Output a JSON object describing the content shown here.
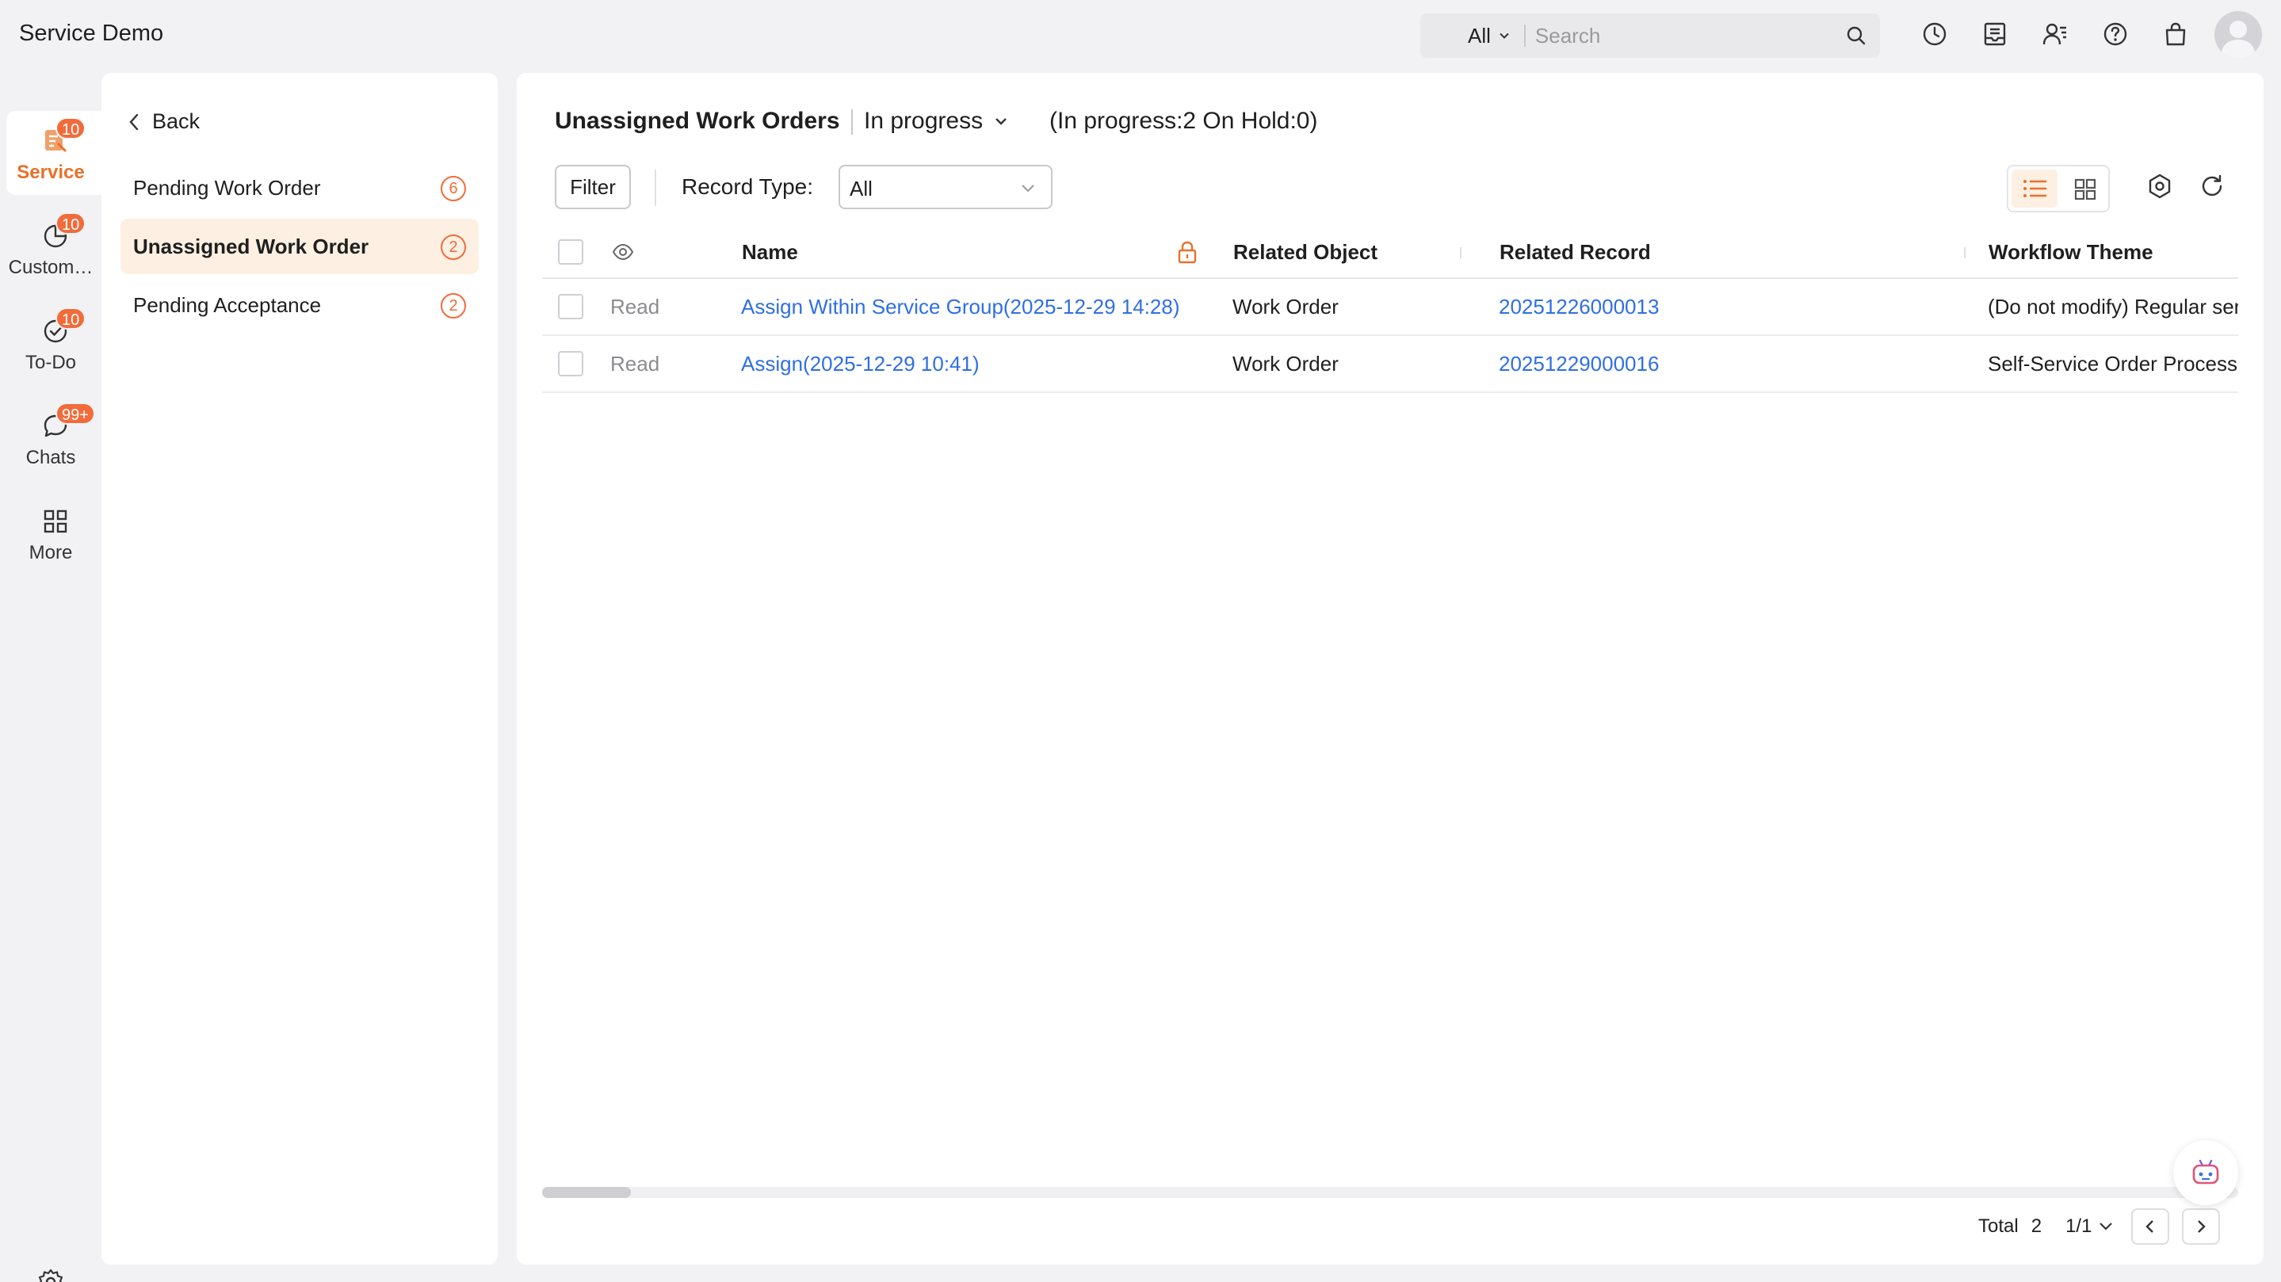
{
  "app": {
    "title": "Service Demo"
  },
  "search": {
    "scope": "All",
    "placeholder": "Search"
  },
  "rail": {
    "items": [
      {
        "label": "Service",
        "badge": "10",
        "icon": "service-icon",
        "active": true
      },
      {
        "label": "Custom…",
        "badge": "10",
        "icon": "pie-chart-icon"
      },
      {
        "label": "To-Do",
        "badge": "10",
        "icon": "check-circle-icon"
      },
      {
        "label": "Chats",
        "badge": "99+",
        "icon": "chat-bubble-icon"
      },
      {
        "label": "More",
        "icon": "grid-icon"
      }
    ]
  },
  "subnav": {
    "back_label": "Back",
    "items": [
      {
        "label": "Pending Work Order",
        "count": "6"
      },
      {
        "label": "Unassigned Work Order",
        "count": "2",
        "active": true
      },
      {
        "label": "Pending Acceptance",
        "count": "2"
      }
    ]
  },
  "main": {
    "title": "Unassigned Work Orders",
    "status": "In progress",
    "summary": "(In progress:2 On Hold:0)",
    "filter_label": "Filter",
    "record_type_label": "Record Type:",
    "record_type_value": "All"
  },
  "table": {
    "columns": [
      "Name",
      "Related Object",
      "Related Record",
      "Workflow Theme"
    ],
    "rows": [
      {
        "read": "Read",
        "name": "Assign Within Service Group(2025-12-29 14:28)",
        "object": "Work Order",
        "record": "20251226000013",
        "theme": "(Do not modify) Regular ser"
      },
      {
        "read": "Read",
        "name": "Assign(2025-12-29 10:41)",
        "object": "Work Order",
        "record": "20251229000016",
        "theme": "Self-Service Order Process"
      }
    ]
  },
  "pager": {
    "total_label": "Total",
    "total": "2",
    "page": "1/1"
  },
  "colors": {
    "accent": "#e8702a",
    "badge": "#f26b3a",
    "link": "#2f6fe4",
    "active_bg": "#fdf0e3"
  }
}
